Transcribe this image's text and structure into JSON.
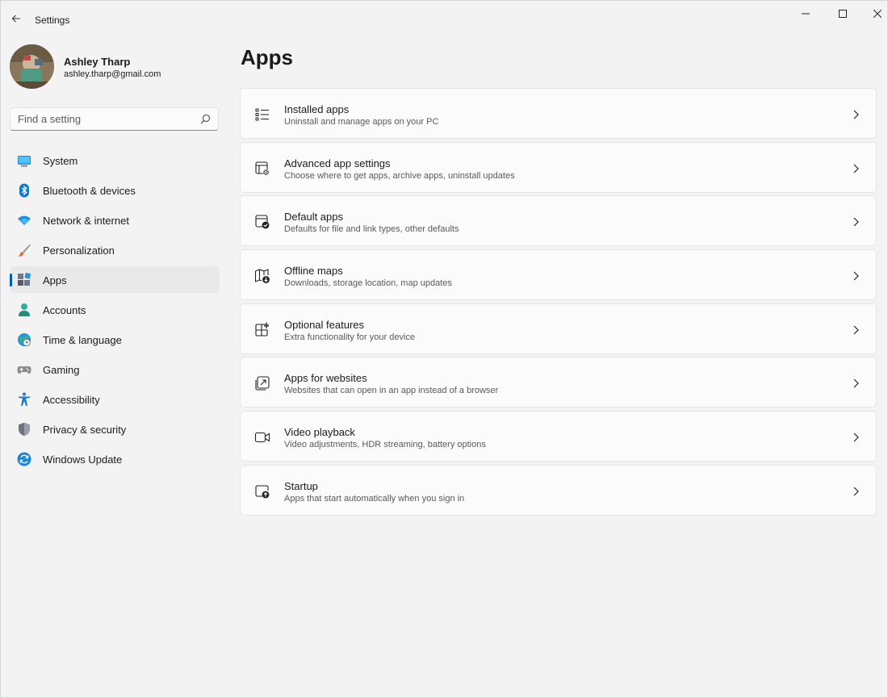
{
  "window": {
    "title": "Settings",
    "back_icon": "back-arrow-icon",
    "controls": [
      "minimize-icon",
      "maximize-icon",
      "close-icon"
    ]
  },
  "profile": {
    "name": "Ashley Tharp",
    "email": "ashley.tharp@gmail.com"
  },
  "search": {
    "placeholder": "Find a setting",
    "value": ""
  },
  "sidebar": {
    "active": "Apps",
    "items": [
      {
        "label": "System",
        "icon": "system-icon"
      },
      {
        "label": "Bluetooth & devices",
        "icon": "bluetooth-icon"
      },
      {
        "label": "Network & internet",
        "icon": "wifi-icon"
      },
      {
        "label": "Personalization",
        "icon": "brush-icon"
      },
      {
        "label": "Apps",
        "icon": "apps-icon"
      },
      {
        "label": "Accounts",
        "icon": "accounts-icon"
      },
      {
        "label": "Time & language",
        "icon": "globe-clock-icon"
      },
      {
        "label": "Gaming",
        "icon": "gamepad-icon"
      },
      {
        "label": "Accessibility",
        "icon": "accessibility-icon"
      },
      {
        "label": "Privacy & security",
        "icon": "shield-icon"
      },
      {
        "label": "Windows Update",
        "icon": "update-icon"
      }
    ]
  },
  "main": {
    "title": "Apps",
    "cards": [
      {
        "title": "Installed apps",
        "subtitle": "Uninstall and manage apps on your PC",
        "icon": "list-icon"
      },
      {
        "title": "Advanced app settings",
        "subtitle": "Choose where to get apps, archive apps, uninstall updates",
        "icon": "app-settings-icon"
      },
      {
        "title": "Default apps",
        "subtitle": "Defaults for file and link types, other defaults",
        "icon": "default-apps-icon"
      },
      {
        "title": "Offline maps",
        "subtitle": "Downloads, storage location, map updates",
        "icon": "map-download-icon"
      },
      {
        "title": "Optional features",
        "subtitle": "Extra functionality for your device",
        "icon": "add-grid-icon"
      },
      {
        "title": "Apps for websites",
        "subtitle": "Websites that can open in an app instead of a browser",
        "icon": "open-in-app-icon"
      },
      {
        "title": "Video playback",
        "subtitle": "Video adjustments, HDR streaming, battery options",
        "icon": "video-icon"
      },
      {
        "title": "Startup",
        "subtitle": "Apps that start automatically when you sign in",
        "icon": "startup-icon"
      }
    ]
  },
  "colors": {
    "accent": "#005fb8",
    "background": "#f3f3f3",
    "card": "#fbfbfb"
  }
}
